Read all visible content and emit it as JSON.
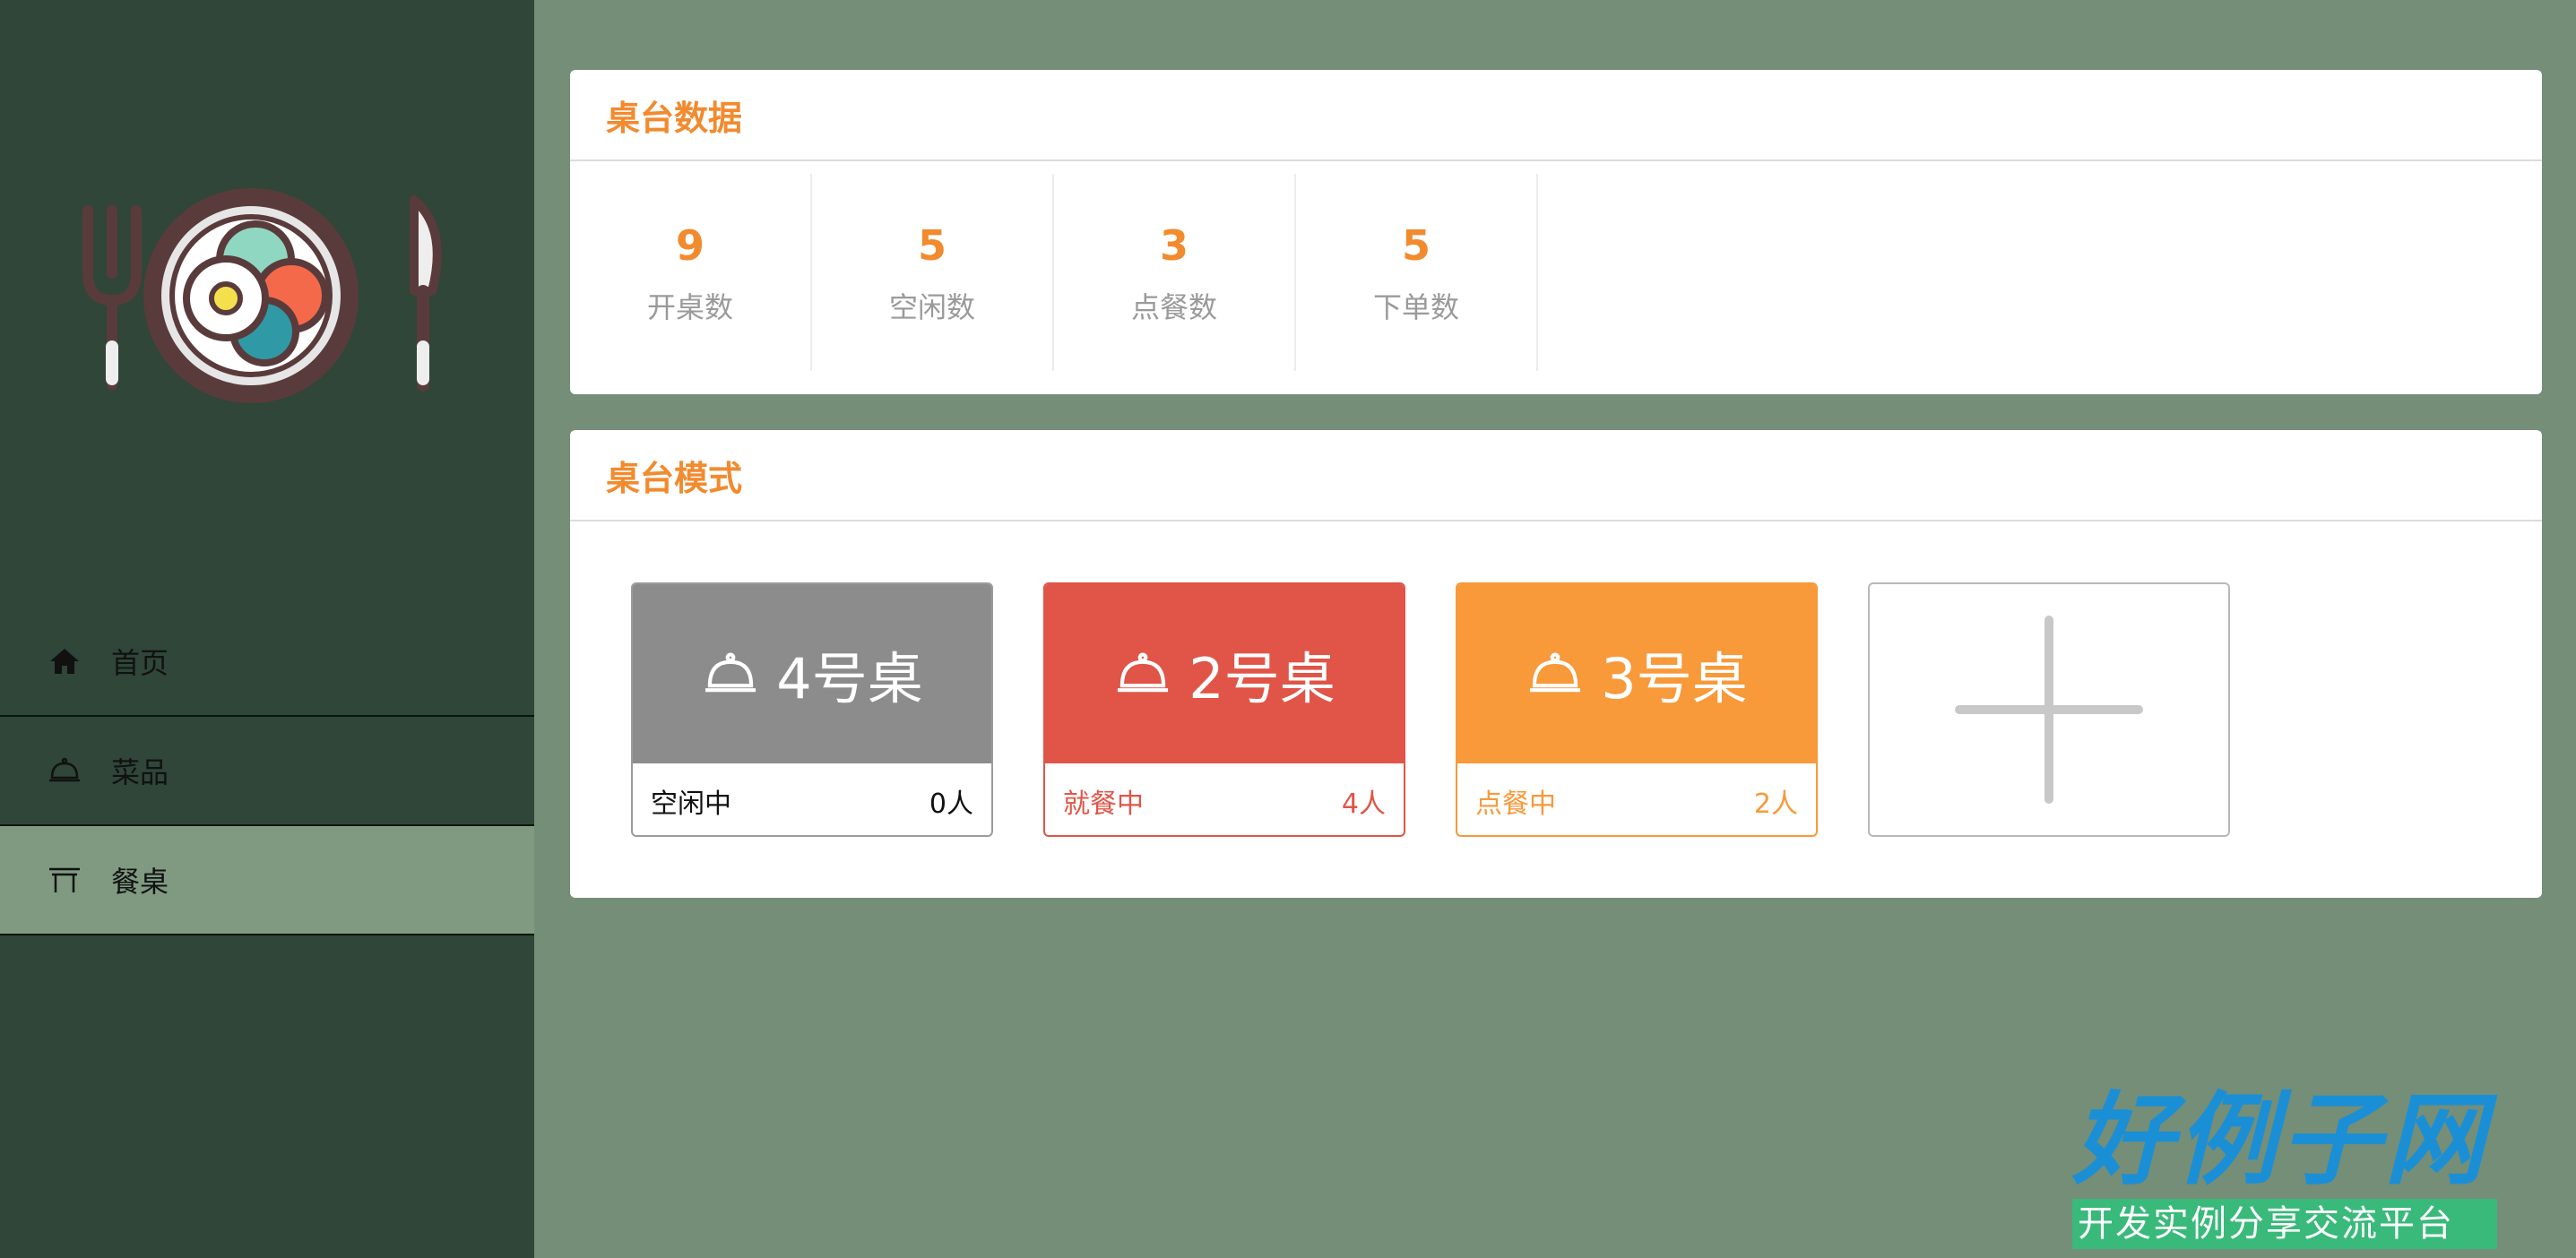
{
  "nav": {
    "items": [
      {
        "label": "首页",
        "icon": "home-icon",
        "active": false
      },
      {
        "label": "菜品",
        "icon": "dish-dome-icon",
        "active": false
      },
      {
        "label": "餐桌",
        "icon": "table-icon",
        "active": true
      }
    ]
  },
  "stats_panel": {
    "title": "桌台数据",
    "stats": [
      {
        "value": "9",
        "label": "开桌数"
      },
      {
        "value": "5",
        "label": "空闲数"
      },
      {
        "value": "3",
        "label": "点餐数"
      },
      {
        "value": "5",
        "label": "下单数"
      }
    ]
  },
  "tables_panel": {
    "title": "桌台模式",
    "tables": [
      {
        "name": "4号桌",
        "status": "空闲中",
        "people": "0人",
        "color": "#8c8c8c"
      },
      {
        "name": "2号桌",
        "status": "就餐中",
        "people": "4人",
        "color": "#e05547"
      },
      {
        "name": "3号桌",
        "status": "点餐中",
        "people": "2人",
        "color": "#f8993a"
      }
    ],
    "add_icon": "plus-icon"
  },
  "brand": {
    "title": "好例子网",
    "subtitle": "开发实例分享交流平台"
  },
  "colors": {
    "accent": "#f28a2e",
    "sidebar": "#2f4638",
    "background": "#758e77"
  }
}
